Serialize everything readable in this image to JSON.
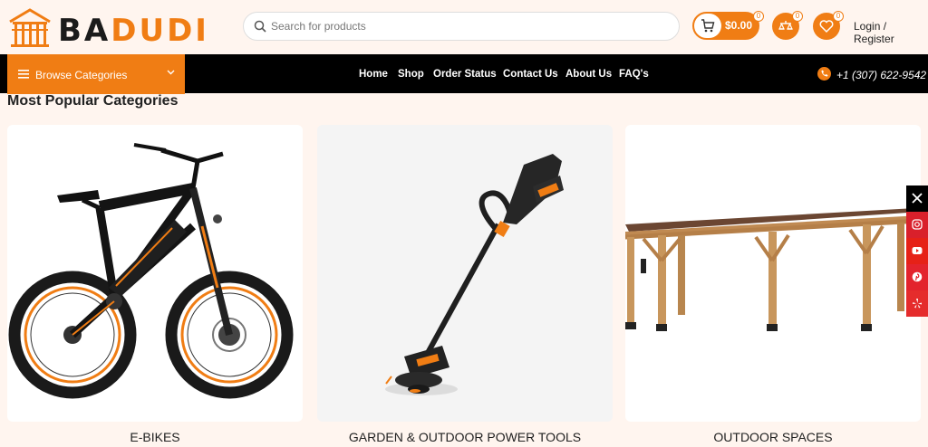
{
  "brand": {
    "logo_text_dark": "BA",
    "logo_text_orange": "DUDI",
    "accent_color": "#f07d14"
  },
  "search": {
    "placeholder": "Search for products",
    "value": ""
  },
  "cart": {
    "total": "$0.00",
    "count": "0",
    "icon": "cart-icon"
  },
  "compare": {
    "count": "0",
    "icon": "compare-icon"
  },
  "wishlist": {
    "count": "0",
    "icon": "heart-icon"
  },
  "account": {
    "label": "Login / Register"
  },
  "browse": {
    "label": "Browse Categories",
    "icon": "hamburger-icon"
  },
  "nav": {
    "items": [
      {
        "label": "Home"
      },
      {
        "label": "Shop"
      },
      {
        "label": "Order Status"
      },
      {
        "label": "Contact Us"
      },
      {
        "label": "About Us"
      },
      {
        "label": "FAQ's"
      }
    ]
  },
  "phone": {
    "number": "+1 (307) 622-9542",
    "icon": "phone-icon"
  },
  "section": {
    "title": "Most Popular Categories"
  },
  "categories": [
    {
      "label": "E-BIKES",
      "image": "e-bike-image"
    },
    {
      "label": "GARDEN & OUTDOOR POWER TOOLS",
      "image": "string-trimmer-image"
    },
    {
      "label": "OUTDOOR SPACES",
      "image": "pergola-image"
    }
  ],
  "social": [
    {
      "name": "x-icon",
      "color": "#000000"
    },
    {
      "name": "instagram-icon",
      "color": "#d9202b"
    },
    {
      "name": "youtube-icon",
      "color": "#e62117"
    },
    {
      "name": "pinterest-icon",
      "color": "#e3232d"
    },
    {
      "name": "yelp-icon",
      "color": "#e52c2c"
    }
  ]
}
